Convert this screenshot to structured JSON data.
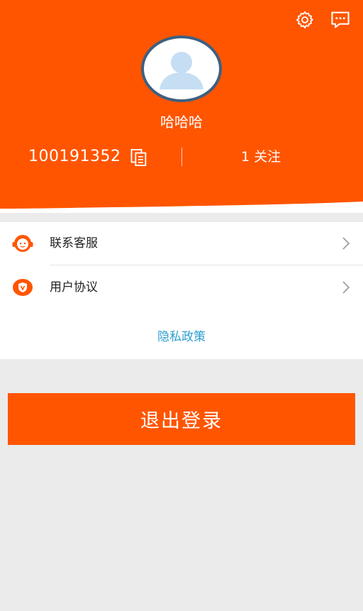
{
  "profile": {
    "nickname": "哈哈哈",
    "user_id": "100191352",
    "follow_text": "1 关注"
  },
  "menu": {
    "items": [
      {
        "label": "联系客服",
        "icon": "customer-service-icon"
      },
      {
        "label": "用户协议",
        "icon": "agreement-icon"
      }
    ],
    "privacy_link": "隐私政策"
  },
  "actions": {
    "logout_label": "退出登录"
  },
  "icons": {
    "settings": "gear-icon",
    "messages": "chat-bubble-icon",
    "copy": "copy-icon",
    "chevron": "chevron-right-icon"
  },
  "colors": {
    "brand": "#ff5500",
    "link": "#2f9fd1",
    "background": "#ebebeb"
  }
}
